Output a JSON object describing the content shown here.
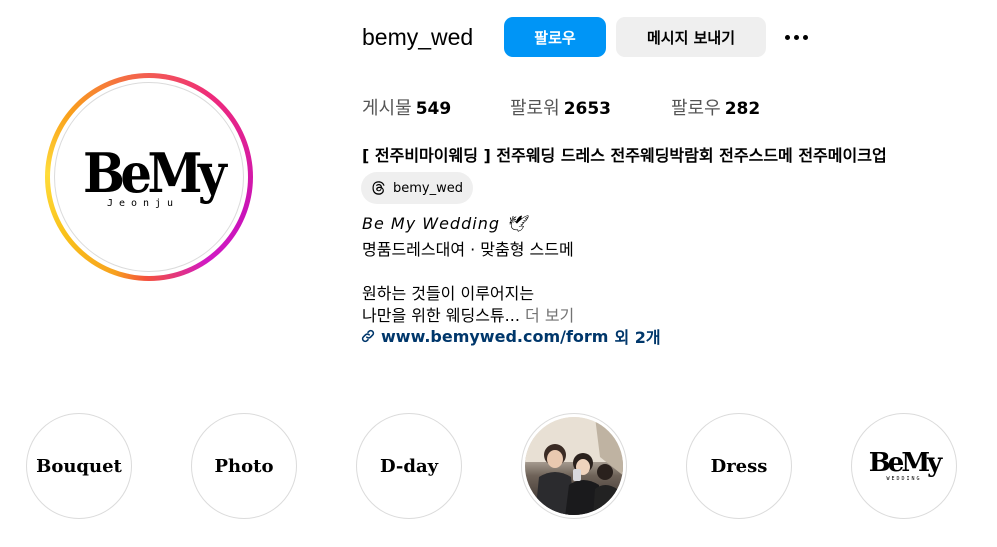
{
  "profile": {
    "avatar_logo": "BeMy",
    "avatar_logo_sub": "Jeonju",
    "username": "bemy_wed",
    "follow_label": "팔로우",
    "message_label": "메시지 보내기",
    "more_icon": "more-horizontal-icon"
  },
  "stats": {
    "posts_label": "게시물",
    "posts_count": "549",
    "followers_label": "팔로워",
    "followers_count": "2653",
    "following_label": "팔로우",
    "following_count": "282"
  },
  "bio": {
    "full_name": "[ 전주비마이웨딩 ] 전주웨딩 드레스 전주웨딩박람회 전주스드메 전주메이크업",
    "threads_handle": "bemy_wed",
    "line1": "Be My Wedding 🕊",
    "line2": "명품드레스대여 · 맞춤형 스드메",
    "line3": "원하는 것들이 이루어지는",
    "line4": "나만을 위한 웨딩스튜...",
    "more_label": "더 보기",
    "link_text": "www.bemywed.com/form",
    "link_extra": "외 2개"
  },
  "highlights": [
    {
      "label": "Bouquet"
    },
    {
      "label": "Photo"
    },
    {
      "label": "D-day"
    },
    {
      "label": ""
    },
    {
      "label": "Dress"
    },
    {
      "label": "BeMy",
      "sub": "WEDDING"
    }
  ],
  "colors": {
    "accent": "#0095f6",
    "link": "#00376b",
    "secondary_button": "#efefef",
    "muted_text": "#737373"
  }
}
